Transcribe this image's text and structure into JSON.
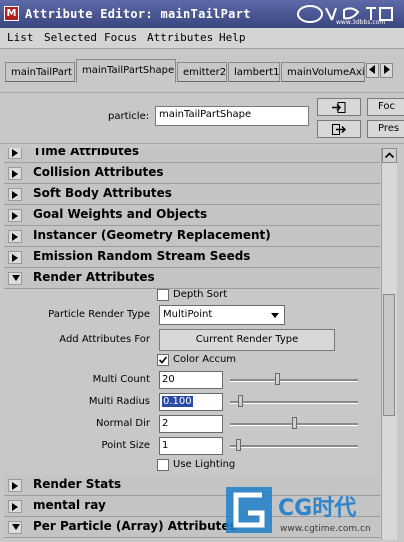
{
  "window": {
    "title": "Attribute Editor: mainTailPart",
    "app_icon": "maya-icon",
    "watermark_top": "www.3dbbs.com"
  },
  "menubar": [
    "List",
    "Selected",
    "Focus",
    "Attributes",
    "Help"
  ],
  "tabs": [
    {
      "label": "mainTailPart",
      "active": false
    },
    {
      "label": "mainTailPartShape",
      "active": true
    },
    {
      "label": "emitter2",
      "active": false
    },
    {
      "label": "lambert1",
      "active": false
    },
    {
      "label": "mainVolumeAxis",
      "active": false
    }
  ],
  "tab_arrows": [
    "arrow-left-icon",
    "arrow-right-icon"
  ],
  "header": {
    "particle_label": "particle:",
    "particle_value": "mainTailPartShape",
    "focus_label": "Foc",
    "presets_label": "Pres",
    "load_icon": "input-connection-icon",
    "output_icon": "output-connection-icon"
  },
  "sections_top": [
    {
      "label": "Time Attributes",
      "expanded": false
    },
    {
      "label": "Collision Attributes",
      "expanded": false
    },
    {
      "label": "Soft Body Attributes",
      "expanded": false
    },
    {
      "label": "Goal Weights and Objects",
      "expanded": false
    },
    {
      "label": "Instancer (Geometry Replacement)",
      "expanded": false
    },
    {
      "label": "Emission Random Stream Seeds",
      "expanded": false
    }
  ],
  "render_attributes": {
    "section_label": "Render Attributes",
    "expanded": true,
    "depth_sort": {
      "label": "Depth Sort",
      "checked": false
    },
    "particle_render_type": {
      "label": "Particle Render Type",
      "value": "MultiPoint"
    },
    "add_attributes_for": {
      "label": "Add Attributes For",
      "button_label": "Current Render Type"
    },
    "color_accum": {
      "label": "Color Accum",
      "checked": true
    },
    "multi_count": {
      "label": "Multi Count",
      "value": "20",
      "slider_fraction": 0.35
    },
    "multi_radius": {
      "label": "Multi Radius",
      "value": "0.100",
      "slider_fraction": 0.02
    },
    "normal_dir": {
      "label": "Normal Dir",
      "value": "2",
      "slider_fraction": 0.5
    },
    "point_size": {
      "label": "Point Size",
      "value": "1",
      "slider_fraction": 0.0
    },
    "use_lighting": {
      "label": "Use Lighting",
      "checked": false
    }
  },
  "sections_bottom": [
    {
      "label": "Render Stats",
      "expanded": false
    },
    {
      "label": "mental ray",
      "expanded": false
    },
    {
      "label": "Per Particle (Array) Attributes",
      "expanded": true
    }
  ],
  "watermark": {
    "brand": "CG时代",
    "url": "www.cgtime.com.cn"
  }
}
